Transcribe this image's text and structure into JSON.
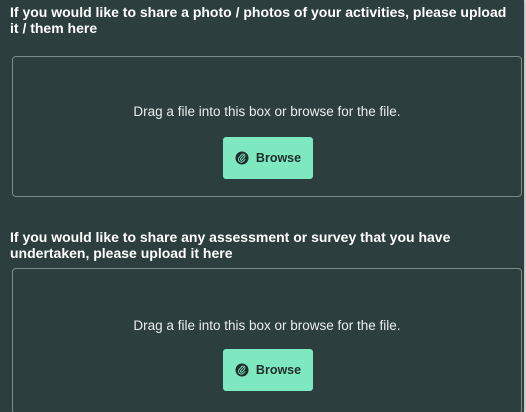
{
  "colors": {
    "panel_background": "#2c3e3d",
    "button_background": "#7ee8c0",
    "dropzone_border": "#7d8c8b",
    "text": "#ffffff"
  },
  "uploads": [
    {
      "label": "If you would like to share a photo / photos of your activities, please upload it / them here",
      "drop_text": "Drag a file into this box or browse for the file.",
      "button_label": "Browse",
      "button_icon": "paperclip-icon"
    },
    {
      "label": "If you would like to share any assessment or survey that you have undertaken, please upload it here",
      "drop_text": "Drag a file into this box or browse for the file.",
      "button_label": "Browse",
      "button_icon": "paperclip-icon"
    }
  ]
}
